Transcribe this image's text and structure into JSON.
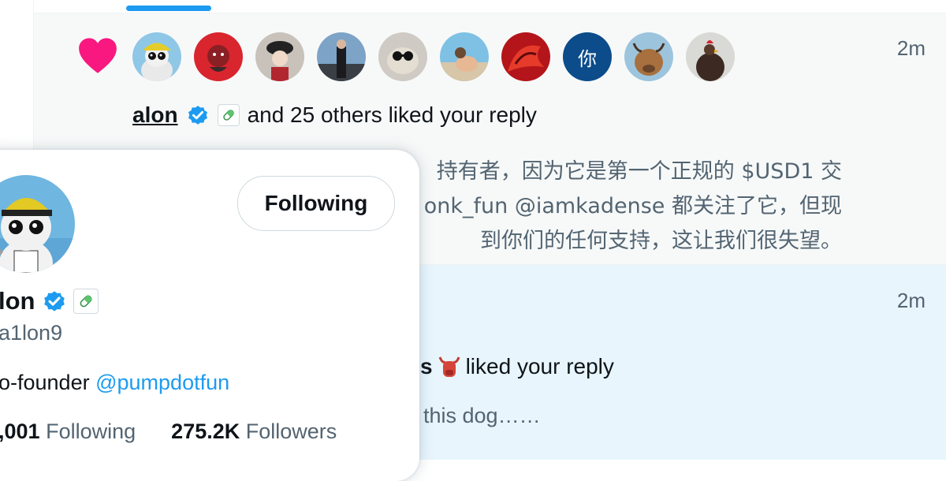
{
  "notification1": {
    "time": "2m",
    "avatars": [
      {
        "name": "avatar-dont-tread-hat"
      },
      {
        "name": "avatar-red-art"
      },
      {
        "name": "avatar-bucket-hat"
      },
      {
        "name": "avatar-suit-car"
      },
      {
        "name": "avatar-pug-glasses"
      },
      {
        "name": "avatar-beach"
      },
      {
        "name": "avatar-red-dragon"
      },
      {
        "name": "avatar-ni",
        "text": "你"
      },
      {
        "name": "avatar-bull"
      },
      {
        "name": "avatar-rooster"
      }
    ],
    "liker_name": "alon",
    "liked_suffix": "and 25 others liked your reply",
    "reply_lines": [
      "持有者，因为它是第一个正规的 $USD1 交",
      "onk_fun @iamkadense 都关注了它，但现",
      "到你们的任何支持，这让我们很失望。"
    ]
  },
  "notification2": {
    "time": "2m",
    "liker_tail": "s",
    "liked_suffix": "liked your reply",
    "reply_text": "this dog……"
  },
  "hovercard": {
    "follow_label": "Following",
    "name": "lon",
    "handle": "a1lon9",
    "bio_prefix": "o-founder",
    "bio_mention": "@pumpdotfun",
    "following_count": ",001",
    "following_label": "Following",
    "followers_count": "275.2K",
    "followers_label": "Followers"
  },
  "colors": {
    "accent": "#1d9bf0",
    "heart": "#f91880",
    "muted_text": "#536471",
    "highlight_bg": "#e8f5fd"
  }
}
